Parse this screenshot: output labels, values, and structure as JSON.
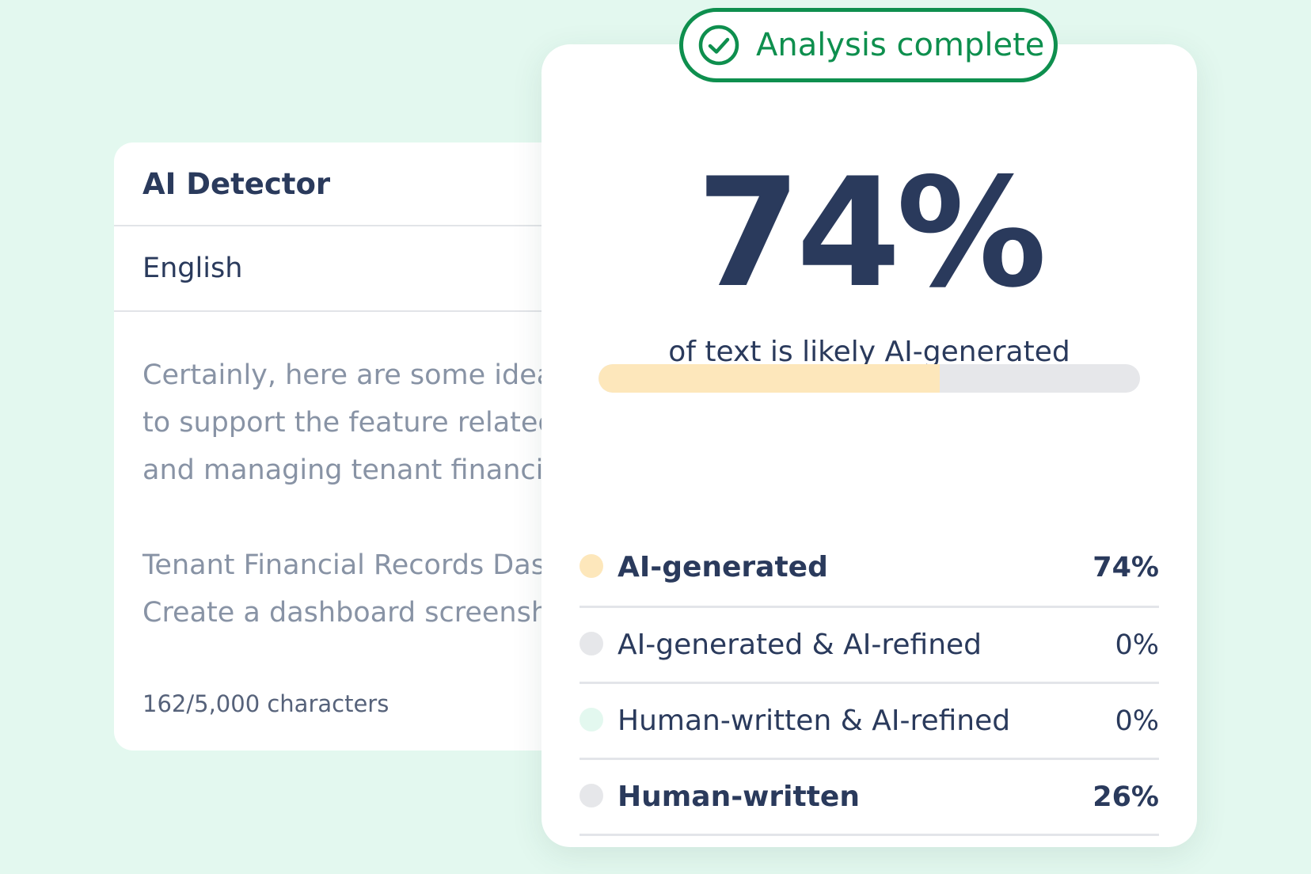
{
  "detector": {
    "title": "AI Detector",
    "language": "English",
    "text_lines": [
      "Certainly, here are some ideas",
      "to support the feature related",
      "and managing tenant financial"
    ],
    "text_lines_2": [
      "Tenant Financial Records Dash",
      "Create a dashboard screensho"
    ],
    "char_count": "162/5,000 characters"
  },
  "result": {
    "status": "Analysis complete",
    "percent": "74%",
    "caption": "of text is likely AI-generated",
    "progress_fraction": 0.63,
    "colors": {
      "accent": "#0e8f4e",
      "ai_generated": "#fde7bb",
      "ai_refined": "#e6e7ea",
      "human_refined": "#e3f8ef",
      "human_written": "#e6e7ea",
      "text": "#2a3a5c"
    },
    "breakdown": [
      {
        "label": "AI-generated",
        "value": "74%",
        "bold": true,
        "color": "#fde7bb"
      },
      {
        "label": "AI-generated & AI-refined",
        "value": "0%",
        "bold": false,
        "color": "#e6e7ea"
      },
      {
        "label": "Human-written & AI-refined",
        "value": "0%",
        "bold": false,
        "color": "#e3f8ef"
      },
      {
        "label": "Human-written",
        "value": "26%",
        "bold": true,
        "color": "#e6e7ea"
      }
    ]
  }
}
